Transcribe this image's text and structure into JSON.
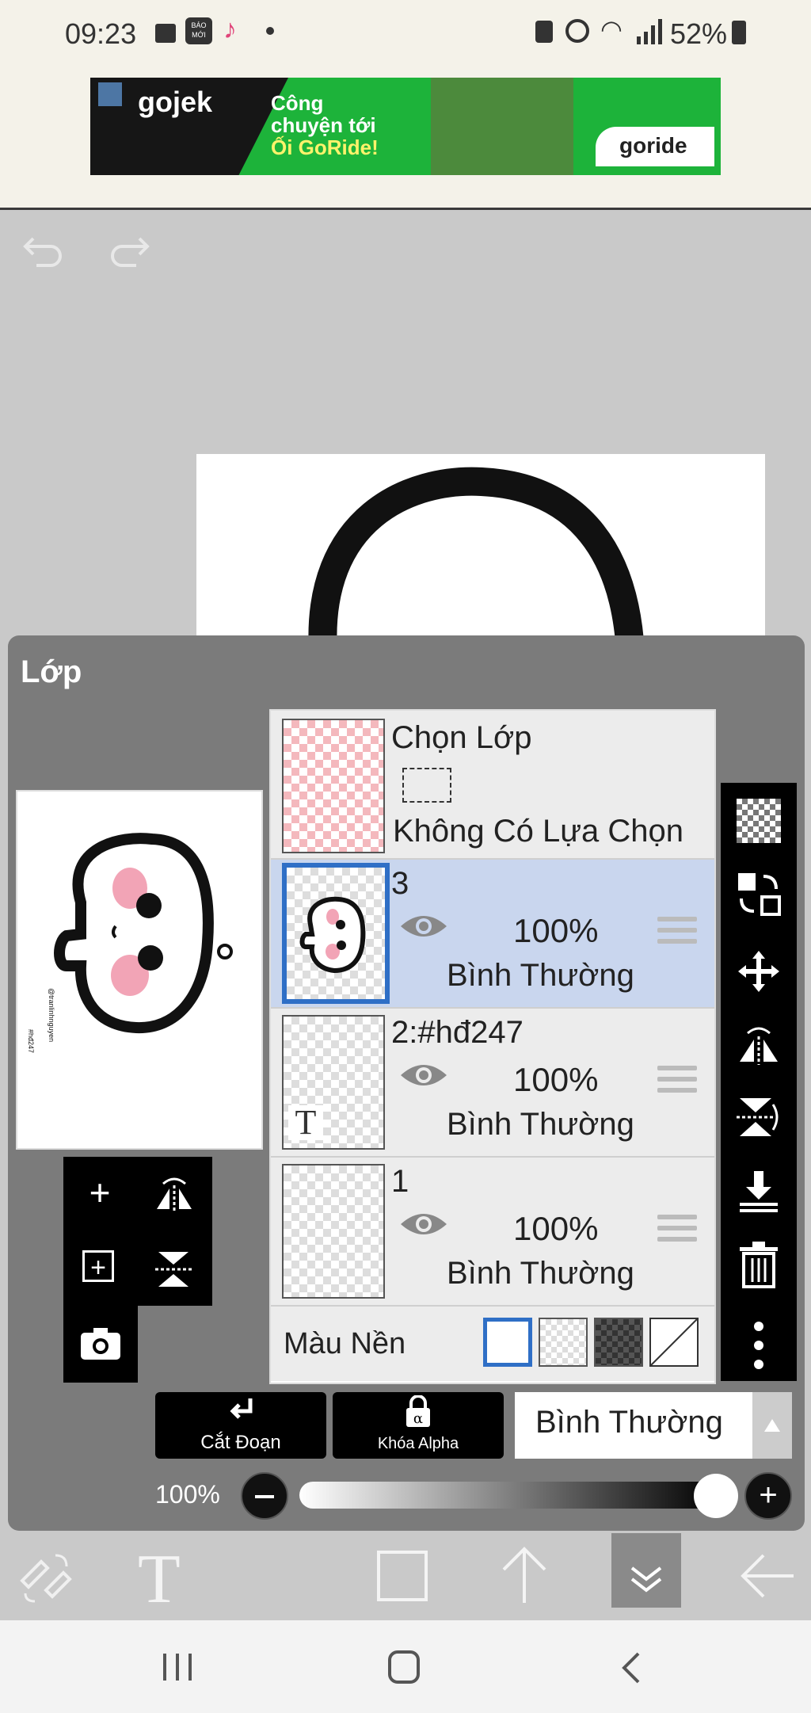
{
  "status": {
    "time": "09:23",
    "battery": "52%",
    "news_badge": "BÁO MỚI"
  },
  "ad": {
    "brand": "gojek",
    "headline_line1": "Công",
    "headline_line2": "chuyện tới",
    "headline_line3": "Ối GoRide!",
    "brand2": "goride"
  },
  "drawing": {
    "watermark1": "@tranlinhnguyen",
    "watermark2": "#hđ247"
  },
  "panel": {
    "title": "Lớp"
  },
  "selection_row": {
    "name": "Chọn Lớp",
    "status": "Không Có Lựa Chọn"
  },
  "layers": [
    {
      "name": "3",
      "opacity": "100%",
      "mode": "Bình Thường",
      "selected": true
    },
    {
      "name": "2:#hđ247",
      "opacity": "100%",
      "mode": "Bình Thường",
      "selected": false,
      "thumb_glyph": "T"
    },
    {
      "name": "1",
      "opacity": "100%",
      "mode": "Bình Thường",
      "selected": false
    }
  ],
  "background_row": {
    "label": "Màu Nền"
  },
  "buttons": {
    "clip": "Cắt Đoạn",
    "alpha_lock": "Khóa Alpha",
    "blend_mode": "Bình Thường"
  },
  "opacity": {
    "value": "100%",
    "level": 1.0
  },
  "colors": {
    "selected_row": "#c9d6ee",
    "accent": "#2f6fc6",
    "ad_green": "#1db33a"
  }
}
